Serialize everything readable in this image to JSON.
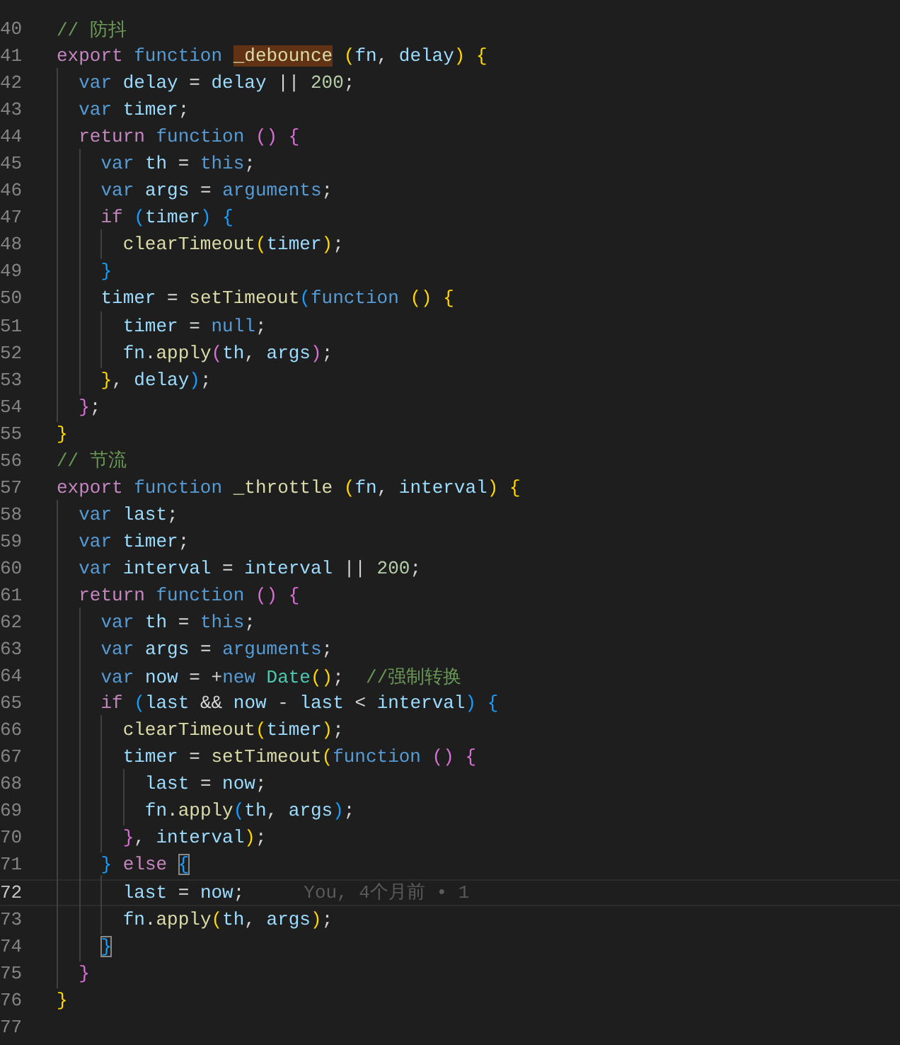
{
  "editor": {
    "lines": [
      {
        "number": "40",
        "current": false,
        "tokens": [
          {
            "text": "// 防抖",
            "kind": "comment"
          }
        ]
      },
      {
        "number": "41",
        "current": false,
        "tokens": [
          {
            "text": "export",
            "kind": "keyword"
          },
          {
            "text": " function ",
            "kind": "storage"
          },
          {
            "text": "_debounce",
            "kind": "highlight"
          },
          {
            "text": " (",
            "kind": "bracket1"
          },
          {
            "text": "fn",
            "kind": "variable"
          },
          {
            "text": ", ",
            "kind": "plain"
          },
          {
            "text": "delay",
            "kind": "variable"
          },
          {
            "text": ")",
            "kind": "bracket1"
          },
          {
            "text": " {",
            "kind": "bracket1"
          }
        ]
      },
      {
        "number": "42",
        "current": false,
        "tokens": [
          {
            "text": "  var",
            "kind": "storage"
          },
          {
            "text": " delay",
            "kind": "variable"
          },
          {
            "text": " = ",
            "kind": "plain"
          },
          {
            "text": "delay",
            "kind": "variable"
          },
          {
            "text": " || ",
            "kind": "plain"
          },
          {
            "text": "200",
            "kind": "number"
          },
          {
            "text": ";",
            "kind": "plain"
          }
        ]
      },
      {
        "number": "43",
        "current": false,
        "tokens": [
          {
            "text": "  var",
            "kind": "storage"
          },
          {
            "text": " timer",
            "kind": "variable"
          },
          {
            "text": ";",
            "kind": "plain"
          }
        ]
      },
      {
        "number": "44",
        "current": false,
        "tokens": [
          {
            "text": "  return",
            "kind": "keyword"
          },
          {
            "text": " function",
            "kind": "storage"
          },
          {
            "text": " ()",
            "kind": "bracket2"
          },
          {
            "text": " {",
            "kind": "bracket2"
          }
        ]
      },
      {
        "number": "45",
        "current": false,
        "tokens": [
          {
            "text": "    var",
            "kind": "storage"
          },
          {
            "text": " th",
            "kind": "variable"
          },
          {
            "text": " = ",
            "kind": "plain"
          },
          {
            "text": "this",
            "kind": "storage"
          },
          {
            "text": ";",
            "kind": "plain"
          }
        ]
      },
      {
        "number": "46",
        "current": false,
        "tokens": [
          {
            "text": "    var",
            "kind": "storage"
          },
          {
            "text": " args",
            "kind": "variable"
          },
          {
            "text": " = ",
            "kind": "plain"
          },
          {
            "text": "arguments",
            "kind": "storage"
          },
          {
            "text": ";",
            "kind": "plain"
          }
        ]
      },
      {
        "number": "47",
        "current": false,
        "tokens": [
          {
            "text": "    if",
            "kind": "keyword"
          },
          {
            "text": " (",
            "kind": "bracket3"
          },
          {
            "text": "timer",
            "kind": "variable"
          },
          {
            "text": ")",
            "kind": "bracket3"
          },
          {
            "text": " {",
            "kind": "bracket3"
          }
        ]
      },
      {
        "number": "48",
        "current": false,
        "tokens": [
          {
            "text": "      clearTimeout",
            "kind": "function"
          },
          {
            "text": "(",
            "kind": "bracket1"
          },
          {
            "text": "timer",
            "kind": "variable"
          },
          {
            "text": ")",
            "kind": "bracket1"
          },
          {
            "text": ";",
            "kind": "plain"
          }
        ]
      },
      {
        "number": "49",
        "current": false,
        "tokens": [
          {
            "text": "    }",
            "kind": "bracket3"
          }
        ]
      },
      {
        "number": "50",
        "current": false,
        "tokens": [
          {
            "text": "    timer",
            "kind": "variable"
          },
          {
            "text": " = ",
            "kind": "plain"
          },
          {
            "text": "setTimeout",
            "kind": "function"
          },
          {
            "text": "(",
            "kind": "bracket3"
          },
          {
            "text": "function",
            "kind": "storage"
          },
          {
            "text": " ()",
            "kind": "bracket1"
          },
          {
            "text": " {",
            "kind": "bracket1"
          }
        ]
      },
      {
        "number": "51",
        "current": false,
        "tokens": [
          {
            "text": "      timer",
            "kind": "variable"
          },
          {
            "text": " = ",
            "kind": "plain"
          },
          {
            "text": "null",
            "kind": "storage"
          },
          {
            "text": ";",
            "kind": "plain"
          }
        ]
      },
      {
        "number": "52",
        "current": false,
        "tokens": [
          {
            "text": "      fn",
            "kind": "variable"
          },
          {
            "text": ".",
            "kind": "plain"
          },
          {
            "text": "apply",
            "kind": "function"
          },
          {
            "text": "(",
            "kind": "bracket2"
          },
          {
            "text": "th",
            "kind": "variable"
          },
          {
            "text": ", ",
            "kind": "plain"
          },
          {
            "text": "args",
            "kind": "variable"
          },
          {
            "text": ")",
            "kind": "bracket2"
          },
          {
            "text": ";",
            "kind": "plain"
          }
        ]
      },
      {
        "number": "53",
        "current": false,
        "tokens": [
          {
            "text": "    }",
            "kind": "bracket1"
          },
          {
            "text": ", ",
            "kind": "plain"
          },
          {
            "text": "delay",
            "kind": "variable"
          },
          {
            "text": ")",
            "kind": "bracket3"
          },
          {
            "text": ";",
            "kind": "plain"
          }
        ]
      },
      {
        "number": "54",
        "current": false,
        "tokens": [
          {
            "text": "  }",
            "kind": "bracket2"
          },
          {
            "text": ";",
            "kind": "plain"
          }
        ]
      },
      {
        "number": "55",
        "current": false,
        "tokens": [
          {
            "text": "}",
            "kind": "bracket1"
          }
        ]
      },
      {
        "number": "56",
        "current": false,
        "tokens": [
          {
            "text": "// 节流",
            "kind": "comment"
          }
        ]
      },
      {
        "number": "57",
        "current": false,
        "tokens": [
          {
            "text": "export",
            "kind": "keyword"
          },
          {
            "text": " function",
            "kind": "storage"
          },
          {
            "text": " _throttle",
            "kind": "function"
          },
          {
            "text": " (",
            "kind": "bracket1"
          },
          {
            "text": "fn",
            "kind": "variable"
          },
          {
            "text": ", ",
            "kind": "plain"
          },
          {
            "text": "interval",
            "kind": "variable"
          },
          {
            "text": ")",
            "kind": "bracket1"
          },
          {
            "text": " {",
            "kind": "bracket1"
          }
        ]
      },
      {
        "number": "58",
        "current": false,
        "tokens": [
          {
            "text": "  var",
            "kind": "storage"
          },
          {
            "text": " last",
            "kind": "variable"
          },
          {
            "text": ";",
            "kind": "plain"
          }
        ]
      },
      {
        "number": "59",
        "current": false,
        "tokens": [
          {
            "text": "  var",
            "kind": "storage"
          },
          {
            "text": " timer",
            "kind": "variable"
          },
          {
            "text": ";",
            "kind": "plain"
          }
        ]
      },
      {
        "number": "60",
        "current": false,
        "tokens": [
          {
            "text": "  var",
            "kind": "storage"
          },
          {
            "text": " interval",
            "kind": "variable"
          },
          {
            "text": " = ",
            "kind": "plain"
          },
          {
            "text": "interval",
            "kind": "variable"
          },
          {
            "text": " || ",
            "kind": "plain"
          },
          {
            "text": "200",
            "kind": "number"
          },
          {
            "text": ";",
            "kind": "plain"
          }
        ]
      },
      {
        "number": "61",
        "current": false,
        "tokens": [
          {
            "text": "  return",
            "kind": "keyword"
          },
          {
            "text": " function",
            "kind": "storage"
          },
          {
            "text": " ()",
            "kind": "bracket2"
          },
          {
            "text": " {",
            "kind": "bracket2"
          }
        ]
      },
      {
        "number": "62",
        "current": false,
        "tokens": [
          {
            "text": "    var",
            "kind": "storage"
          },
          {
            "text": " th",
            "kind": "variable"
          },
          {
            "text": " = ",
            "kind": "plain"
          },
          {
            "text": "this",
            "kind": "storage"
          },
          {
            "text": ";",
            "kind": "plain"
          }
        ]
      },
      {
        "number": "63",
        "current": false,
        "tokens": [
          {
            "text": "    var",
            "kind": "storage"
          },
          {
            "text": " args",
            "kind": "variable"
          },
          {
            "text": " = ",
            "kind": "plain"
          },
          {
            "text": "arguments",
            "kind": "storage"
          },
          {
            "text": ";",
            "kind": "plain"
          }
        ]
      },
      {
        "number": "64",
        "current": false,
        "tokens": [
          {
            "text": "    var",
            "kind": "storage"
          },
          {
            "text": " now",
            "kind": "variable"
          },
          {
            "text": " = +",
            "kind": "plain"
          },
          {
            "text": "new",
            "kind": "storage"
          },
          {
            "text": " Date",
            "kind": "class"
          },
          {
            "text": "()",
            "kind": "bracket1"
          },
          {
            "text": ";",
            "kind": "plain"
          },
          {
            "text": "  //强制转换",
            "kind": "comment"
          }
        ]
      },
      {
        "number": "65",
        "current": false,
        "tokens": [
          {
            "text": "    if",
            "kind": "keyword"
          },
          {
            "text": " (",
            "kind": "bracket3"
          },
          {
            "text": "last",
            "kind": "variable"
          },
          {
            "text": " && ",
            "kind": "plain"
          },
          {
            "text": "now",
            "kind": "variable"
          },
          {
            "text": " - ",
            "kind": "plain"
          },
          {
            "text": "last",
            "kind": "variable"
          },
          {
            "text": " < ",
            "kind": "plain"
          },
          {
            "text": "interval",
            "kind": "variable"
          },
          {
            "text": ")",
            "kind": "bracket3"
          },
          {
            "text": " {",
            "kind": "bracket3"
          }
        ]
      },
      {
        "number": "66",
        "current": false,
        "tokens": [
          {
            "text": "      clearTimeout",
            "kind": "function"
          },
          {
            "text": "(",
            "kind": "bracket1"
          },
          {
            "text": "timer",
            "kind": "variable"
          },
          {
            "text": ")",
            "kind": "bracket1"
          },
          {
            "text": ";",
            "kind": "plain"
          }
        ]
      },
      {
        "number": "67",
        "current": false,
        "tokens": [
          {
            "text": "      timer",
            "kind": "variable"
          },
          {
            "text": " = ",
            "kind": "plain"
          },
          {
            "text": "setTimeout",
            "kind": "function"
          },
          {
            "text": "(",
            "kind": "bracket1"
          },
          {
            "text": "function",
            "kind": "storage"
          },
          {
            "text": " ()",
            "kind": "bracket2"
          },
          {
            "text": " {",
            "kind": "bracket2"
          }
        ]
      },
      {
        "number": "68",
        "current": false,
        "tokens": [
          {
            "text": "        last",
            "kind": "variable"
          },
          {
            "text": " = ",
            "kind": "plain"
          },
          {
            "text": "now",
            "kind": "variable"
          },
          {
            "text": ";",
            "kind": "plain"
          }
        ]
      },
      {
        "number": "69",
        "current": false,
        "tokens": [
          {
            "text": "        fn",
            "kind": "variable"
          },
          {
            "text": ".",
            "kind": "plain"
          },
          {
            "text": "apply",
            "kind": "function"
          },
          {
            "text": "(",
            "kind": "bracket3"
          },
          {
            "text": "th",
            "kind": "variable"
          },
          {
            "text": ", ",
            "kind": "plain"
          },
          {
            "text": "args",
            "kind": "variable"
          },
          {
            "text": ")",
            "kind": "bracket3"
          },
          {
            "text": ";",
            "kind": "plain"
          }
        ]
      },
      {
        "number": "70",
        "current": false,
        "tokens": [
          {
            "text": "      }",
            "kind": "bracket2"
          },
          {
            "text": ", ",
            "kind": "plain"
          },
          {
            "text": "interval",
            "kind": "variable"
          },
          {
            "text": ")",
            "kind": "bracket1"
          },
          {
            "text": ";",
            "kind": "plain"
          }
        ]
      },
      {
        "number": "71",
        "current": false,
        "tokens": [
          {
            "text": "    }",
            "kind": "bracket3"
          },
          {
            "text": " else ",
            "kind": "keyword"
          },
          {
            "text": "{",
            "kind": "matched-bracket"
          }
        ]
      },
      {
        "number": "72",
        "current": true,
        "blame": "You, 4个月前 • 1",
        "tokens": [
          {
            "text": "      last",
            "kind": "variable"
          },
          {
            "text": " = ",
            "kind": "plain"
          },
          {
            "text": "now",
            "kind": "variable"
          },
          {
            "text": ";",
            "kind": "plain"
          }
        ]
      },
      {
        "number": "73",
        "current": false,
        "tokens": [
          {
            "text": "      fn",
            "kind": "variable"
          },
          {
            "text": ".",
            "kind": "plain"
          },
          {
            "text": "apply",
            "kind": "function"
          },
          {
            "text": "(",
            "kind": "bracket1"
          },
          {
            "text": "th",
            "kind": "variable"
          },
          {
            "text": ", ",
            "kind": "plain"
          },
          {
            "text": "args",
            "kind": "variable"
          },
          {
            "text": ")",
            "kind": "bracket1"
          },
          {
            "text": ";",
            "kind": "plain"
          }
        ]
      },
      {
        "number": "74",
        "current": false,
        "tokens": [
          {
            "text": "    }",
            "kind": "matched-bracket"
          }
        ]
      },
      {
        "number": "75",
        "current": false,
        "tokens": [
          {
            "text": "  }",
            "kind": "bracket2"
          }
        ]
      },
      {
        "number": "76",
        "current": false,
        "tokens": [
          {
            "text": "}",
            "kind": "bracket1"
          }
        ]
      },
      {
        "number": "77",
        "current": false
      }
    ]
  }
}
